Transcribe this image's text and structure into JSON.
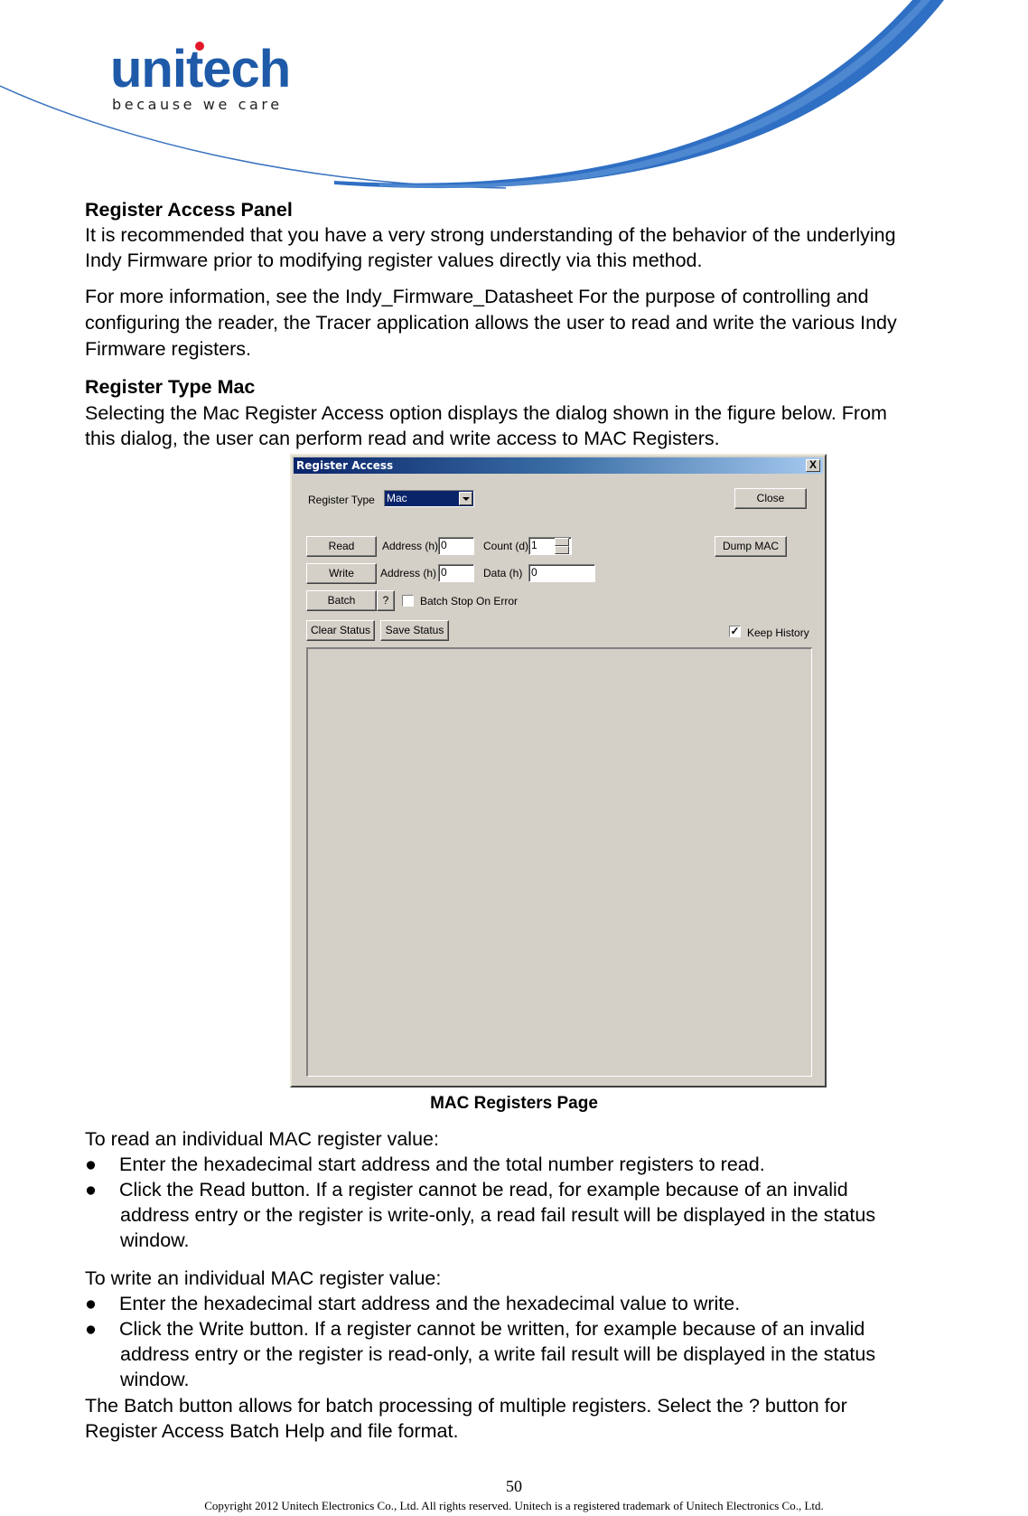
{
  "header": {
    "logo_word": "unitech",
    "logo_tagline": "because we care",
    "brand_color": "#1e5aa8",
    "accent_dot_color": "#e5172a"
  },
  "section1": {
    "heading": "Register Access Panel",
    "para1_lines": [
      "It is recommended that you have a very strong understanding of the behavior of the underlying",
      "Indy Firmware prior to modifying register values directly via this method."
    ],
    "para2_lines": [
      "For more information, see the Indy_Firmware_Datasheet    For the purpose of controlling and",
      "configuring the reader, the Tracer application allows the user to read and write the various Indy",
      "Firmware registers."
    ]
  },
  "section2": {
    "heading": "Register Type Mac",
    "para_lines": [
      "Selecting the Mac Register Access option displays the dialog shown in the figure below. From",
      "this dialog, the user can perform read and write access to MAC Registers."
    ]
  },
  "dialog": {
    "title": "Register Access",
    "close_x": "X",
    "register_type_label": "Register Type",
    "register_type_value": "Mac",
    "close_button": "Close",
    "read_button": "Read",
    "read_address_label": "Address (h)",
    "read_address_value": "0",
    "count_label": "Count (d)",
    "count_value": "1",
    "dump_mac_button": "Dump MAC",
    "write_button": "Write",
    "write_address_label": "Address (h)",
    "write_address_value": "0",
    "data_label": "Data (h)",
    "data_value": "0",
    "batch_button": "Batch",
    "help_button": "?",
    "batch_stop_label": "Batch Stop On Error",
    "batch_stop_checked": false,
    "clear_status_button": "Clear Status",
    "save_status_button": "Save Status",
    "keep_history_label": "Keep History",
    "keep_history_checked": true,
    "checkmark": "✓"
  },
  "figure_caption": "MAC Registers Page",
  "read_section": {
    "intro": "To read an individual MAC register value:",
    "bullet_glyph": "●",
    "bullets": [
      [
        "Enter the hexadecimal start address and the total number registers to read."
      ],
      [
        "Click the Read button. If a register cannot be read, for example because of an invalid",
        "address entry or the register is write-only, a read fail result will be displayed in the status",
        "window."
      ]
    ]
  },
  "write_section": {
    "intro": "To write an individual MAC register value:",
    "bullets": [
      [
        "Enter the hexadecimal start address and the hexadecimal value to write."
      ],
      [
        "Click the Write button. If a register cannot be written, for example because of an invalid",
        "address entry or the register is read-only, a write fail result will be displayed in the status",
        "window."
      ]
    ]
  },
  "batch_para_lines": [
    "The Batch button allows for batch processing of multiple registers. Select the ? button for",
    "Register Access Batch Help and file format."
  ],
  "footer": {
    "page_number": "50",
    "copyright": "Copyright 2012 Unitech Electronics Co., Ltd. All rights reserved. Unitech is a registered trademark of Unitech Electronics Co., Ltd."
  }
}
